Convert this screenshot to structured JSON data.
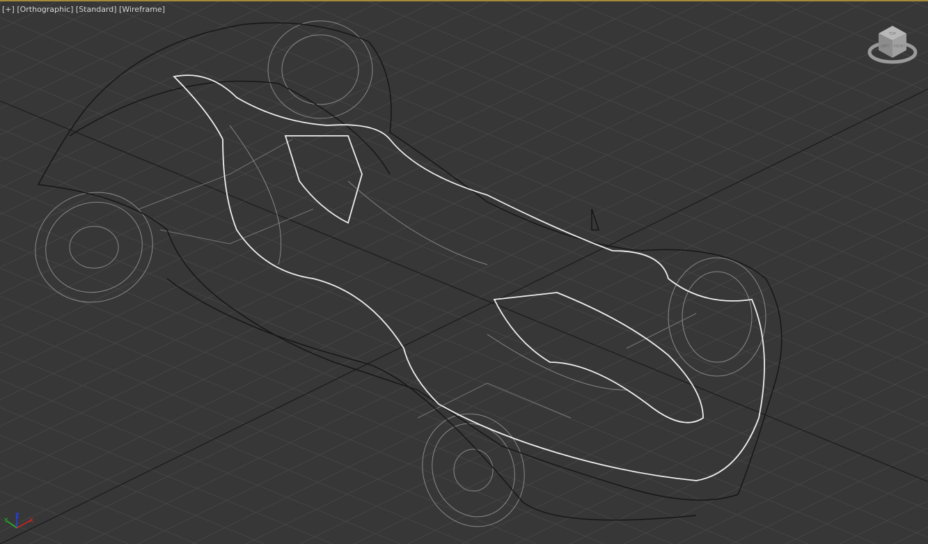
{
  "viewport": {
    "labels": {
      "plus": "[+]",
      "projection": "[Orthographic]",
      "shading_preset": "[Standard]",
      "display_mode": "[Wireframe]"
    },
    "viewcube": {
      "faces": {
        "top": "TOP",
        "left": "LEFT",
        "front": "FRONT"
      }
    },
    "axis_gizmo": {
      "x": "X",
      "y": "Y",
      "z": "Z",
      "colors": {
        "x": "#e02020",
        "y": "#20c020",
        "z": "#2040ff"
      }
    },
    "colors": {
      "background": "#373737",
      "grid": "#454545",
      "active_border": "#a58a3a"
    }
  }
}
